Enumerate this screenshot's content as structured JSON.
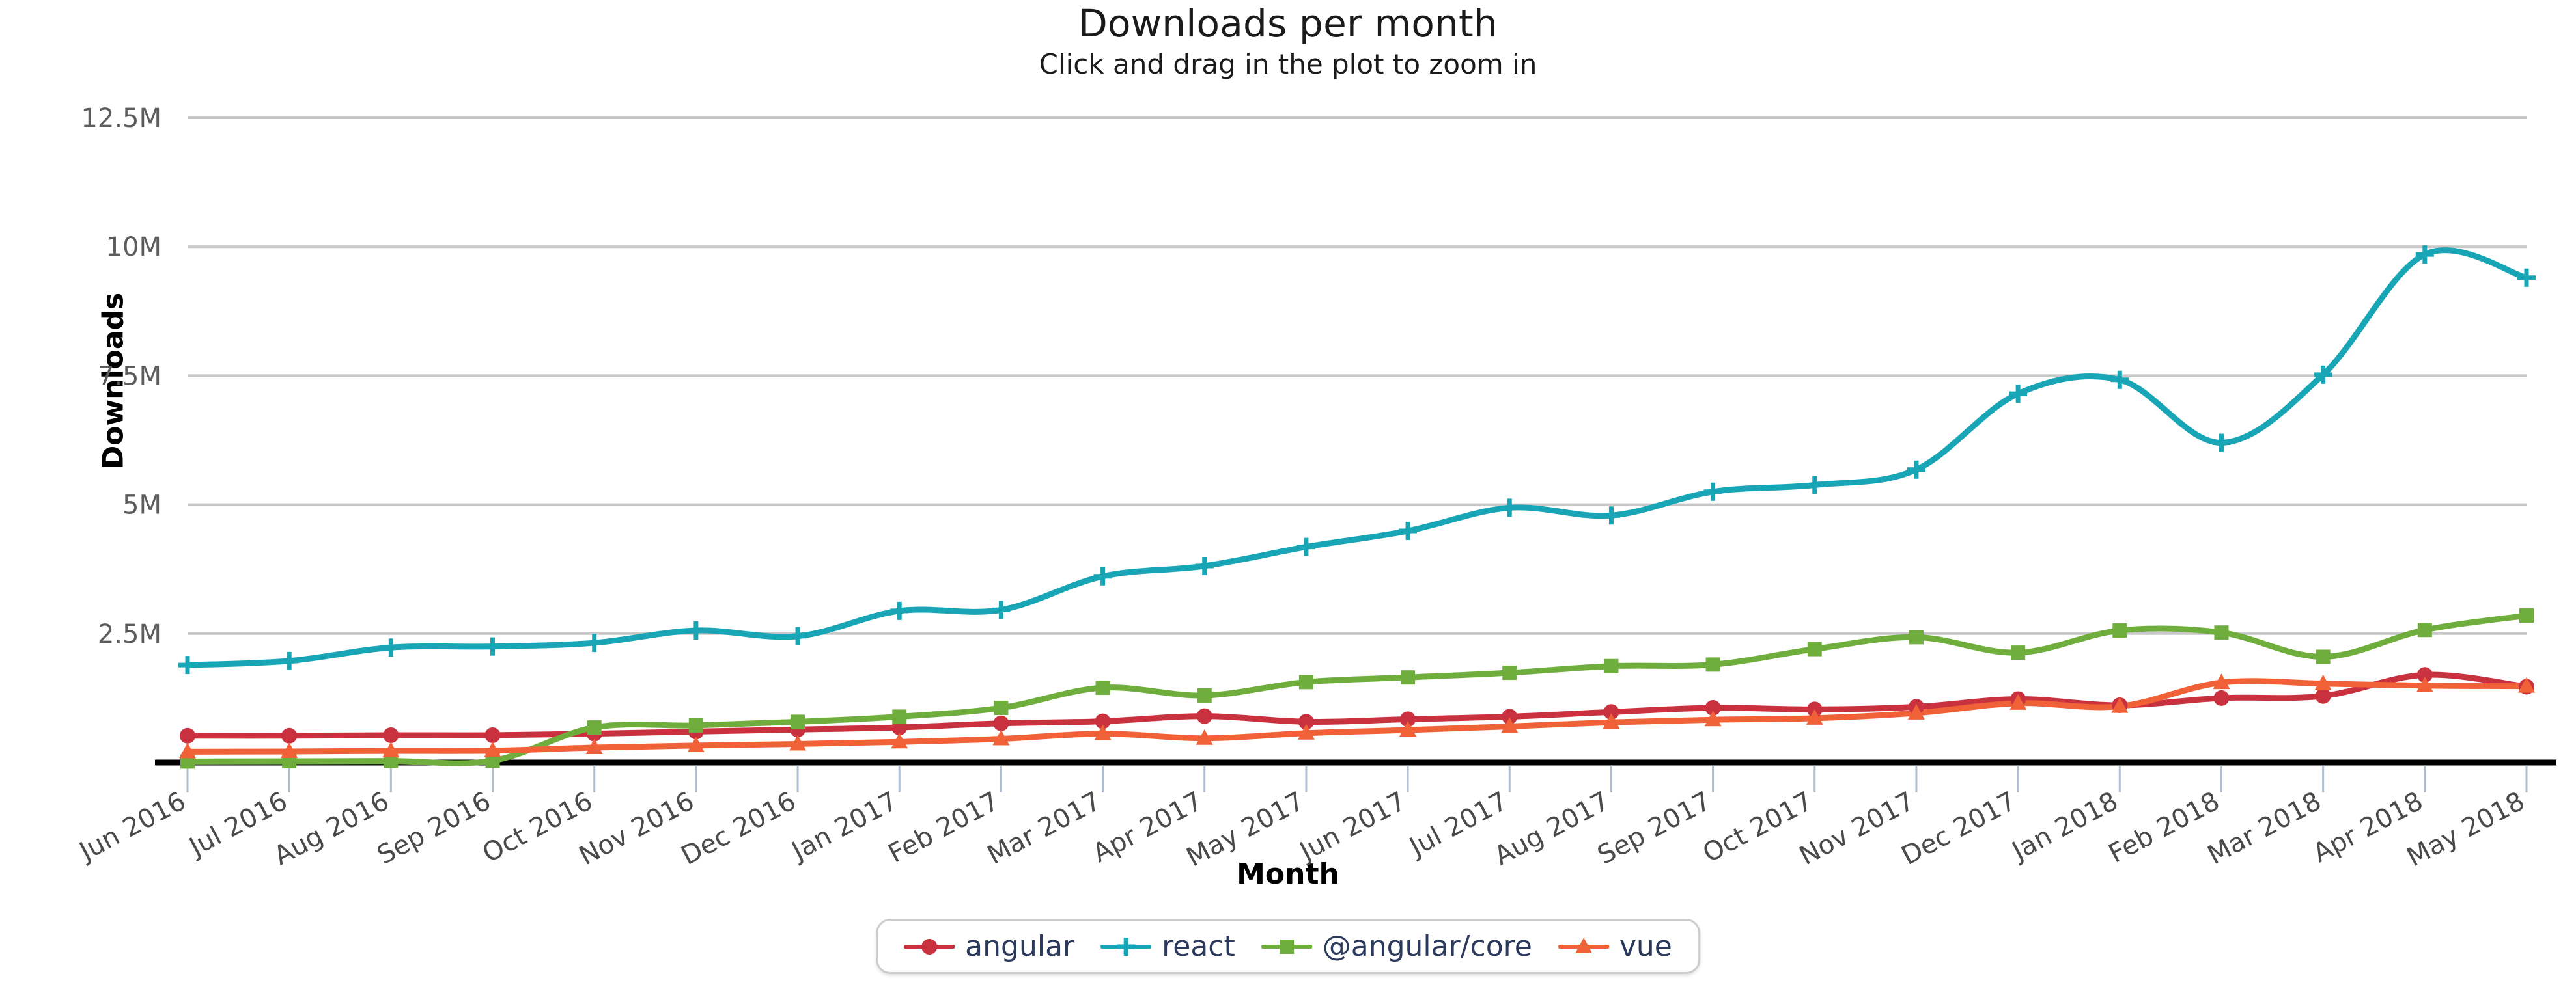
{
  "header": {
    "title": "Downloads per month",
    "subtitle": "Click and drag in the plot to zoom in"
  },
  "axes": {
    "y_title": "Downloads",
    "x_title": "Month"
  },
  "legend": {
    "items": [
      {
        "label": "angular",
        "color": "#c9313f",
        "marker": "circle"
      },
      {
        "label": "react",
        "color": "#18a5b5",
        "marker": "plus"
      },
      {
        "label": "@angular/core",
        "color": "#6fae3c",
        "marker": "square"
      },
      {
        "label": "vue",
        "color": "#f06137",
        "marker": "triangle"
      }
    ]
  },
  "chart_data": {
    "type": "line",
    "title": "Downloads per month",
    "subtitle": "Click and drag in the plot to zoom in",
    "xlabel": "Month",
    "ylabel": "Downloads",
    "ylim": [
      0,
      13200000
    ],
    "ytick_values": [
      2500000,
      5000000,
      7500000,
      10000000,
      12500000
    ],
    "ytick_labels": [
      "2.5M",
      "5M",
      "7.5M",
      "10M",
      "12.5M"
    ],
    "grid": true,
    "legend_position": "bottom",
    "smoothing": "spline",
    "categories": [
      "Jun 2016",
      "Jul 2016",
      "Aug 2016",
      "Sep 2016",
      "Oct 2016",
      "Nov 2016",
      "Dec 2016",
      "Jan 2017",
      "Feb 2017",
      "Mar 2017",
      "Apr 2017",
      "May 2017",
      "Jun 2017",
      "Jul 2017",
      "Aug 2017",
      "Sep 2017",
      "Oct 2017",
      "Nov 2017",
      "Dec 2017",
      "Jan 2018",
      "Feb 2018",
      "Mar 2018",
      "Apr 2018",
      "May 2018"
    ],
    "series": [
      {
        "name": "angular",
        "color": "#c9313f",
        "marker": "circle",
        "values": [
          520000,
          520000,
          530000,
          530000,
          560000,
          600000,
          640000,
          680000,
          760000,
          800000,
          900000,
          790000,
          840000,
          890000,
          980000,
          1060000,
          1030000,
          1080000,
          1230000,
          1110000,
          1250000,
          1290000,
          1700000,
          1470000
        ]
      },
      {
        "name": "react",
        "color": "#18a5b5",
        "marker": "plus",
        "values": [
          1890000,
          1970000,
          2230000,
          2250000,
          2320000,
          2560000,
          2450000,
          2940000,
          2960000,
          3610000,
          3810000,
          4180000,
          4490000,
          4940000,
          4790000,
          5250000,
          5380000,
          5680000,
          7150000,
          7420000,
          6200000,
          7520000,
          9850000,
          9400000
        ]
      },
      {
        "name": "@angular/core",
        "color": "#6fae3c",
        "marker": "square",
        "values": [
          20000,
          25000,
          30000,
          35000,
          680000,
          720000,
          790000,
          890000,
          1060000,
          1450000,
          1300000,
          1560000,
          1650000,
          1740000,
          1870000,
          1900000,
          2200000,
          2430000,
          2130000,
          2560000,
          2520000,
          2050000,
          2570000,
          2850000
        ]
      },
      {
        "name": "vue",
        "color": "#f06137",
        "marker": "triangle",
        "values": [
          210000,
          215000,
          225000,
          230000,
          290000,
          330000,
          360000,
          400000,
          460000,
          560000,
          470000,
          570000,
          630000,
          700000,
          780000,
          830000,
          860000,
          960000,
          1150000,
          1090000,
          1550000,
          1530000,
          1490000,
          1480000
        ]
      }
    ]
  }
}
